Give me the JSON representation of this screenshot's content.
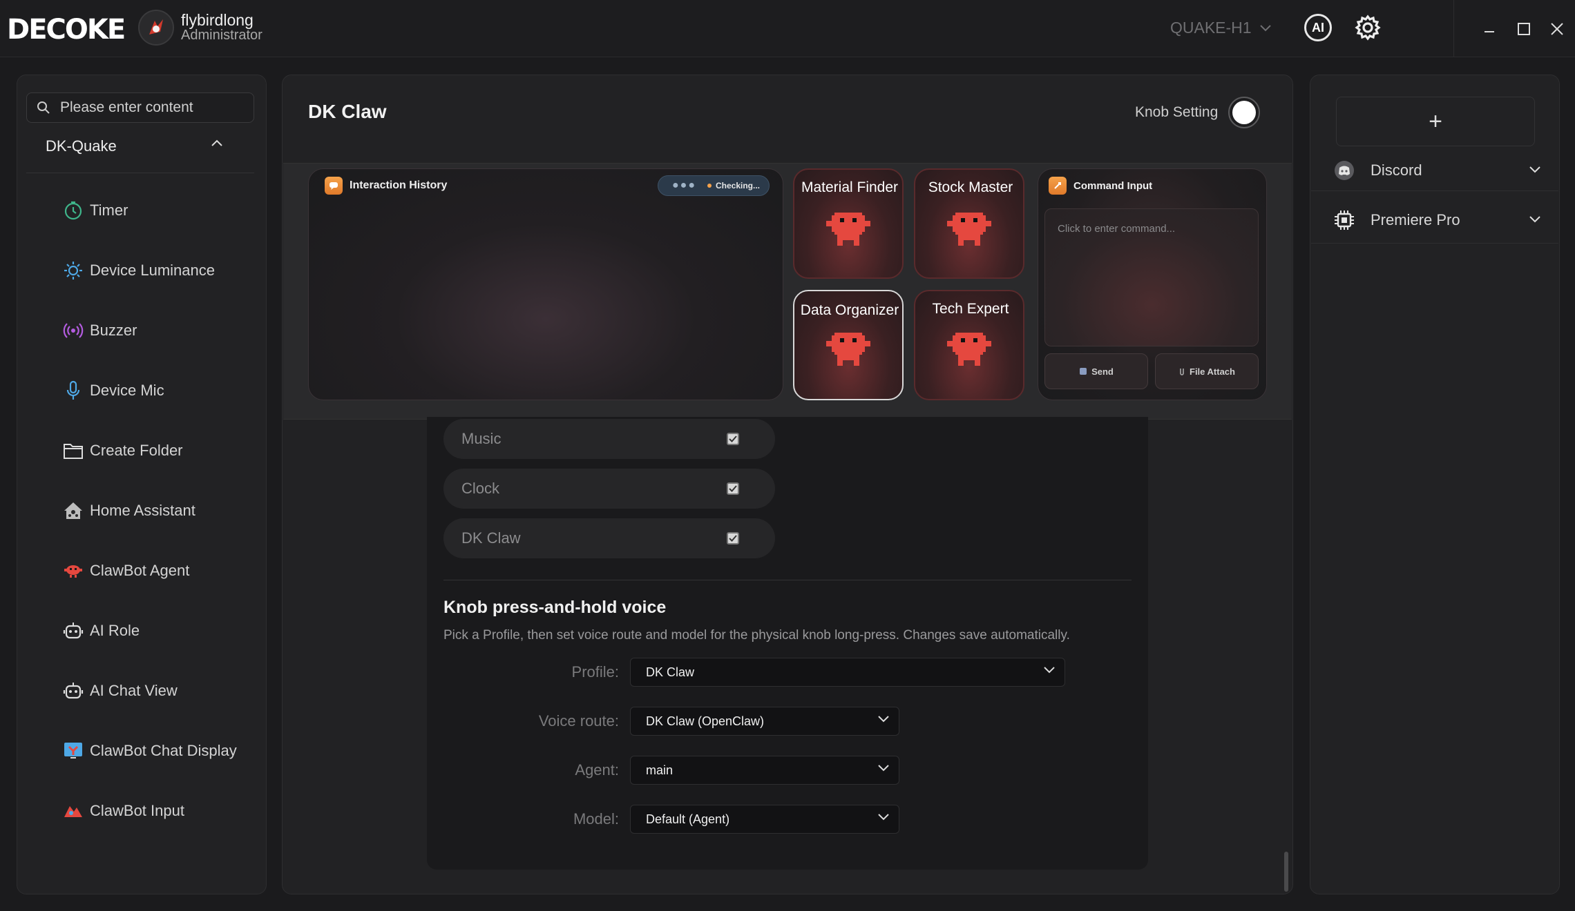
{
  "app": {
    "logo_text": "DECOKEE",
    "user_name": "flybirdlong",
    "user_role": "Administrator",
    "device": "QUAKE-H1",
    "ai_label": "AI"
  },
  "sidebar": {
    "search_placeholder": "Please enter content",
    "group": "DK-Quake",
    "items": [
      {
        "label": "Timer",
        "icon": "timer-icon"
      },
      {
        "label": "Device Luminance",
        "icon": "sun-icon"
      },
      {
        "label": "Buzzer",
        "icon": "buzzer-icon"
      },
      {
        "label": "Device Mic",
        "icon": "microphone-icon"
      },
      {
        "label": "Create Folder",
        "icon": "folder-icon"
      },
      {
        "label": "Home Assistant",
        "icon": "home-assistant-icon"
      },
      {
        "label": "ClawBot Agent",
        "icon": "clawbot-icon"
      },
      {
        "label": "AI Role",
        "icon": "robot-icon"
      },
      {
        "label": "AI Chat View",
        "icon": "robot-icon"
      },
      {
        "label": "ClawBot Chat Display",
        "icon": "chat-display-icon"
      },
      {
        "label": "ClawBot Input",
        "icon": "clawbot-input-icon"
      }
    ]
  },
  "main": {
    "title": "DK Claw",
    "knob_setting": "Knob Setting",
    "interaction_history": "Interaction History",
    "checking": "Checking...",
    "agents": [
      "Material Finder",
      "Stock Master",
      "Data Organizer",
      "Tech Expert"
    ],
    "command_input": {
      "title": "Command Input",
      "placeholder": "Click to enter command...",
      "send": "Send",
      "file_attach": "File Attach"
    },
    "toggles": [
      {
        "label": "Music",
        "checked": true
      },
      {
        "label": "Clock",
        "checked": true
      },
      {
        "label": "DK Claw",
        "checked": true
      }
    ],
    "voice": {
      "title": "Knob press-and-hold voice",
      "description": "Pick a Profile, then set voice route and model for the physical knob long-press. Changes save automatically.",
      "profile_label": "Profile:",
      "profile_value": "DK Claw",
      "route_label": "Voice route:",
      "route_value": "DK Claw (OpenClaw)",
      "agent_label": "Agent:",
      "agent_value": "main",
      "model_label": "Model:",
      "model_value": "Default (Agent)"
    }
  },
  "right_panel": {
    "add": "+",
    "items": [
      {
        "label": "Discord",
        "icon": "discord-icon"
      },
      {
        "label": "Premiere Pro",
        "icon": "chip-icon"
      }
    ]
  },
  "colors": {
    "accent_orange": "#f5a24b",
    "claw_red": "#e5483f",
    "background": "#1b1b1d"
  }
}
